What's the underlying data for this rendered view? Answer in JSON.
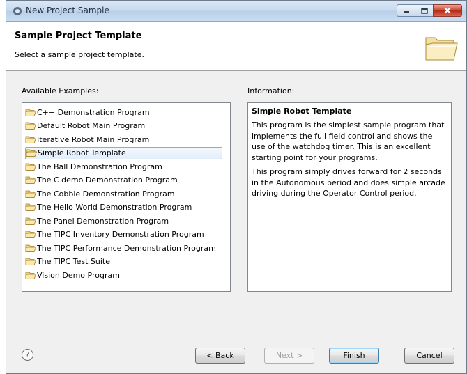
{
  "window": {
    "title": "New Project Sample"
  },
  "header": {
    "title": "Sample Project Template",
    "subtitle": "Select a sample project template."
  },
  "examples": {
    "label": "Available Examples:",
    "items": [
      "C++ Demonstration Program",
      "Default Robot Main Program",
      "Iterative Robot Main Program",
      "Simple Robot Template",
      "The Ball Demonstration Program",
      "The C demo Demonstration Program",
      "The Cobble Demonstration Program",
      "The Hello World Demonstration Program",
      "The Panel Demonstration Program",
      "The TIPC Inventory Demonstration Program",
      "The TIPC Performance Demonstration Program",
      "The TIPC Test Suite",
      "Vision Demo Program"
    ],
    "selected_index": 3
  },
  "information": {
    "label": "Information:",
    "title": "Simple Robot Template",
    "paragraph1": "This program is the simplest sample program that implements the full field control and shows the use of the watchdog timer. This is an excellent starting point for your programs.",
    "paragraph2": "This program simply drives forward for 2 seconds in the Autonomous period and does simple arcade driving during the Operator Control period."
  },
  "buttons": {
    "help": "?",
    "back_prefix": "< ",
    "back_mnemonic": "B",
    "back_rest": "ack",
    "next_mnemonic": "N",
    "next_rest": "ext >",
    "finish_mnemonic": "F",
    "finish_rest": "inish",
    "cancel": "Cancel"
  },
  "colors": {
    "title_bar": "#c5d9ef",
    "selection_border": "#84acdd",
    "folder": "#e8c46a"
  }
}
